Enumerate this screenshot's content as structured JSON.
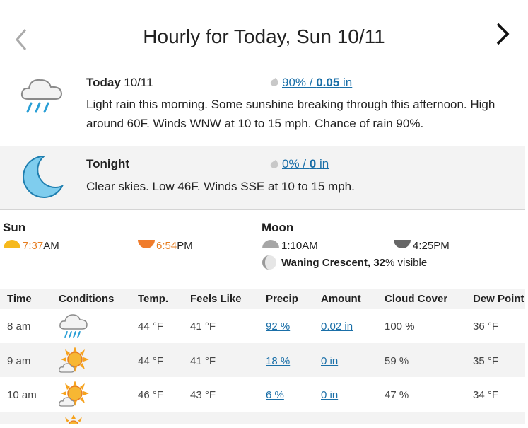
{
  "header": {
    "title": "Hourly for Today, Sun 10/11"
  },
  "today": {
    "label": "Today",
    "date": "10/11",
    "precip_percent": "90%",
    "precip_sep": " / ",
    "precip_amount": "0.05",
    "precip_unit": " in",
    "text_line1": "Light rain this morning. Some sunshine breaking through this afternoon. High",
    "text_line2": "around 60F. Winds WNW at 10 to 15 mph. Chance of rain 90%."
  },
  "tonight": {
    "label": "Tonight",
    "precip_percent": "0%",
    "precip_sep": " / ",
    "precip_amount": "0",
    "precip_unit": " in",
    "text": "Clear skies. Low 46F. Winds SSE at 10 to 15 mph."
  },
  "sun": {
    "heading": "Sun",
    "rise_time": "7:37",
    "rise_suffix": "AM",
    "set_time": "6:54",
    "set_suffix": "PM"
  },
  "moon": {
    "heading": "Moon",
    "rise": "1:10AM",
    "set": "4:25PM",
    "phase": "Waning Crescent,",
    "percent": "32",
    "visible_suffix": "% visible"
  },
  "table": {
    "headers": [
      "Time",
      "Conditions",
      "Temp.",
      "Feels Like",
      "Precip",
      "Amount",
      "Cloud Cover",
      "Dew Point"
    ],
    "rows": [
      {
        "time": "8 am",
        "icon": "rain-icon",
        "temp": "44 °F",
        "feels": "41 °F",
        "precip": "92 %",
        "amount": "0.02 in",
        "cloud": "100 %",
        "dew": "36 °F"
      },
      {
        "time": "9 am",
        "icon": "partly-sunny-icon",
        "temp": "44 °F",
        "feels": "41 °F",
        "precip": "18 %",
        "amount": "0 in",
        "cloud": "59 %",
        "dew": "35 °F"
      },
      {
        "time": "10 am",
        "icon": "partly-sunny-icon",
        "temp": "46 °F",
        "feels": "43 °F",
        "precip": "6 %",
        "amount": "0 in",
        "cloud": "47 %",
        "dew": "34 °F"
      }
    ]
  },
  "colors": {
    "link": "#1a6fa8",
    "sun_orange": "#e67e22",
    "rain_blue": "#2a9fd6",
    "moon_blue": "#7fcdee"
  }
}
